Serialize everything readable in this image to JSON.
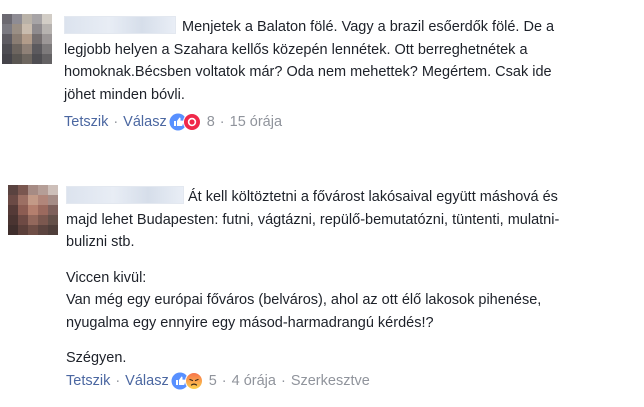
{
  "comments": [
    {
      "lines": [
        "Menjetek a Balaton fölé. Vagy a brazil esőerdők fölé. De a",
        "legjobb helyen a Szahara kellős közepén lennétek. Ott berreghetnétek a",
        "homoknak.Bécsben voltatok már? Oda nem mehettek? Megértem. Csak ide",
        "jöhet minden bóvli."
      ],
      "like_label": "Tetszik",
      "reply_label": "Válasz",
      "reaction_icons": [
        "like-icon",
        "haha-icon"
      ],
      "reaction_count": "8",
      "time": "15 órája"
    },
    {
      "paragraphs": [
        {
          "lines": [
            "Át kell költöztetni a fővárost lakósaival együtt máshová és",
            "majd lehet Budapesten: futni, vágtázni, repülő-bemutatózni, tüntenti, mulatni-",
            "bulizni stb."
          ]
        },
        {
          "lines": [
            "Viccen kivül:",
            "Van még egy európai főváros (belváros), ahol az ott élő lakosok pihenése,",
            "nyugalma egy ennyire egy másod-harmadrangú kérdés!?"
          ]
        },
        {
          "lines": [
            "Szégyen."
          ]
        }
      ],
      "like_label": "Tetszik",
      "reply_label": "Válasz",
      "reaction_icons": [
        "like-icon",
        "angry-icon"
      ],
      "reaction_count": "5",
      "time": "4 órája",
      "edited_label": "Szerkesztve"
    }
  ],
  "colors": {
    "link": "#4b67a1",
    "meta": "#90949c",
    "text": "#1d2129",
    "like_blue": "#5890ff",
    "haha_red": "#f0284a",
    "angry_orange": "#f7714c"
  }
}
